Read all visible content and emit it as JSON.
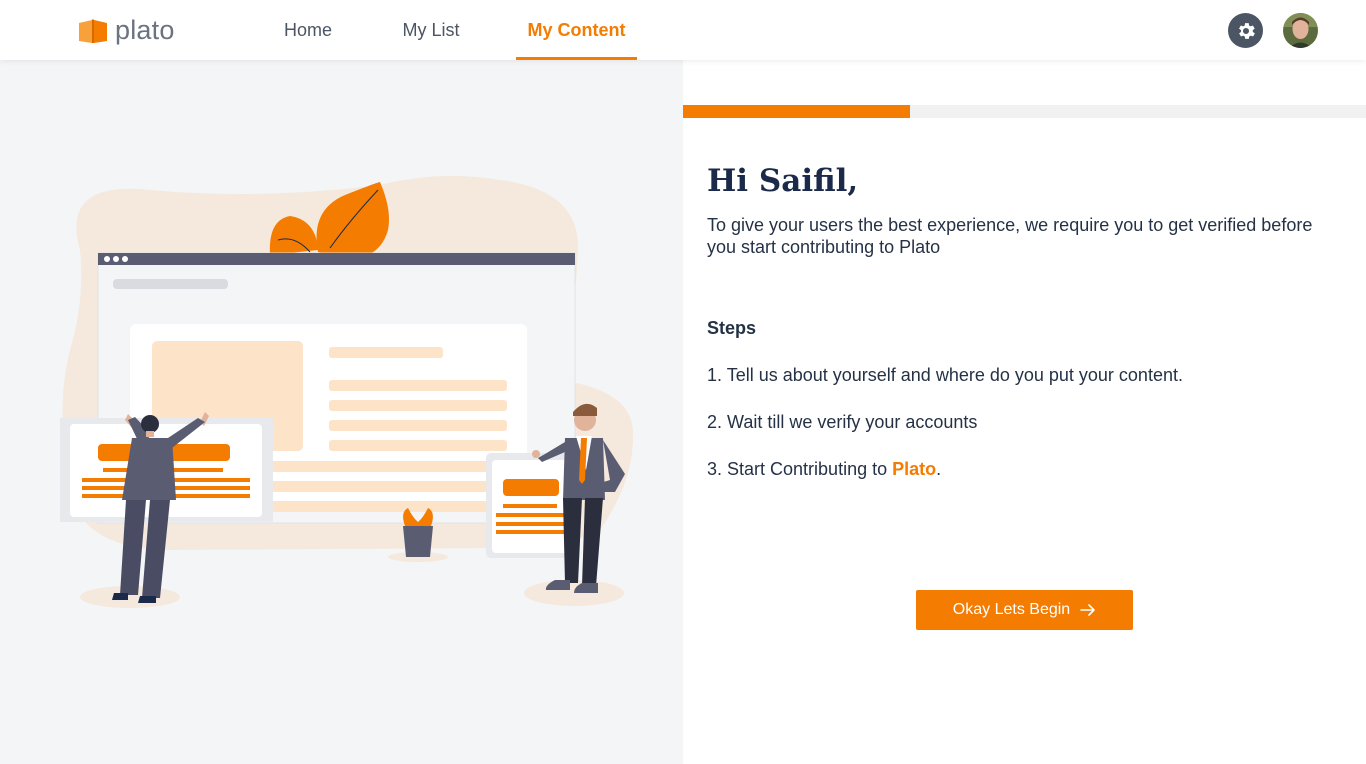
{
  "header": {
    "logo_text": "plato",
    "nav": [
      {
        "label": "Home",
        "active": false
      },
      {
        "label": "My List",
        "active": false
      },
      {
        "label": "My Content",
        "active": true
      }
    ],
    "settings_icon": "gear-icon",
    "avatar_icon": "user-avatar"
  },
  "onboarding": {
    "progress_fraction": 0.333,
    "greeting": "Hi Saifil,",
    "intro": "To give your users the best experience, we require you to get verified before you start contributing to Plato",
    "steps_title": "Steps",
    "steps": [
      {
        "text": "1. Tell us about yourself and where do you put your content."
      },
      {
        "text": "2. Wait till we verify your accounts"
      },
      {
        "text_before": "3. Start Contributing to ",
        "highlight": "Plato",
        "text_after": "."
      }
    ],
    "cta_label": "Okay Lets Begin",
    "cta_icon": "arrow-right-icon"
  },
  "colors": {
    "accent": "#f47c00",
    "heading": "#1b2a4a",
    "nav_text": "#4b5563",
    "left_panel_bg": "#f4f5f7"
  }
}
